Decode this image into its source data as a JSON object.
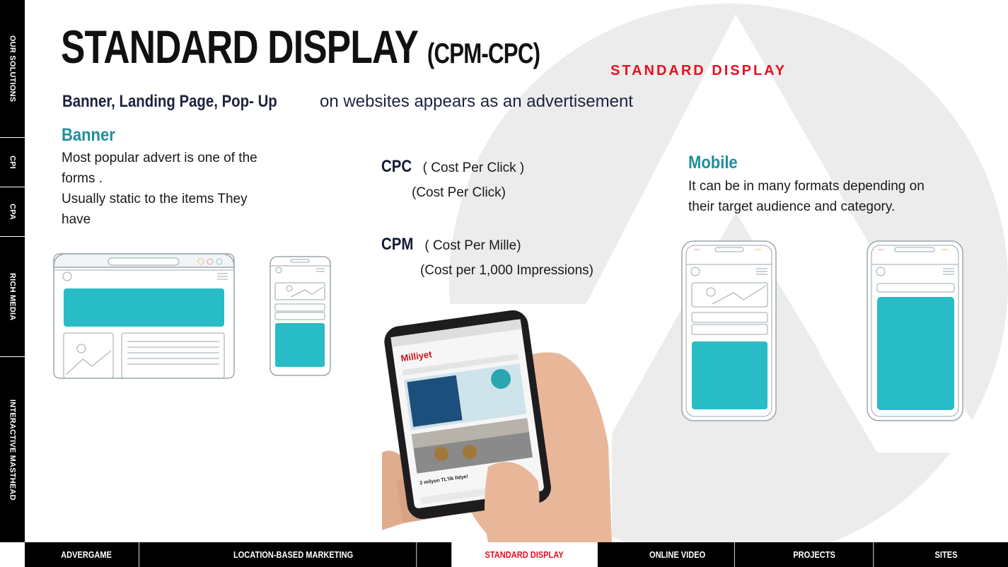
{
  "title": {
    "main": "STANDARD DISPLAY",
    "suffix": "(CPM-CPC)",
    "label": "STANDARD DISPLAY"
  },
  "lead": {
    "bold": "Banner, Landing Page, Pop- Up",
    "rest": " on websites  appears as an advertisement"
  },
  "banner": {
    "heading": "Banner",
    "line1": "Most popular advert is one of the",
    "line2": "forms .",
    "line3": "Usually static to the items They",
    "line4": "have"
  },
  "cpc": {
    "abbr": "CPC",
    "paren": "( Cost Per Click )",
    "desc": "(Cost Per Click)"
  },
  "cpm": {
    "abbr": "CPM",
    "paren": "( Cost Per Mille)",
    "desc": "(Cost per 1,000 Impressions)"
  },
  "mobile": {
    "heading": "Mobile",
    "line1": "It can be in many formats depending on",
    "line2": "their target audience and category."
  },
  "phone_screen": {
    "brand": "Milliyet",
    "headline": "2 milyon TL'lik fidye!"
  },
  "sidebar": {
    "items": [
      {
        "label": "OUR SOLUTIONS"
      },
      {
        "label": "CPI"
      },
      {
        "label": "CPA"
      },
      {
        "label": "RICH MEDIA"
      },
      {
        "label": "INTERACTIVE MASTHEAD"
      }
    ]
  },
  "bottom_nav": {
    "items": [
      {
        "label": "ADVERGAME"
      },
      {
        "label": "LOCATION-BASED MARKETING"
      },
      {
        "label": "STANDARD DISPLAY",
        "active": true
      },
      {
        "label": "ONLINE VIDEO"
      },
      {
        "label": "PROJECTS"
      },
      {
        "label": "SITES"
      }
    ]
  },
  "colors": {
    "accent_red": "#e8101f",
    "teal": "#1f8f9c",
    "ad_block": "#27bcc6",
    "nav_bg": "#000000"
  }
}
